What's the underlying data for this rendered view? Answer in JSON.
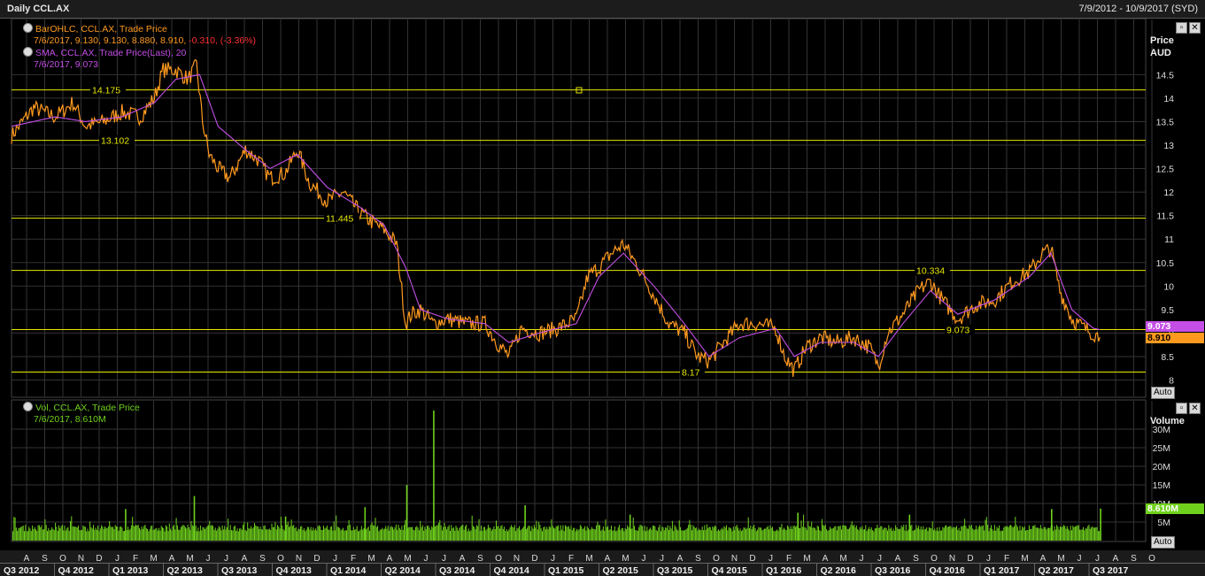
{
  "header": {
    "title": "Daily CCL.AX",
    "range": "7/9/2012 - 10/9/2017 (SYD)"
  },
  "legend": {
    "ohlc_name": "BarOHLC, CCL.AX, Trade Price",
    "ohlc_values": "7/6/2017, 9.130, 9.130, 8.880, 8.910,",
    "ohlc_change": "-0.310, (-3.36%)",
    "sma_name": "SMA, CCL.AX, Trade Price(Last), ",
    "sma_period": "20",
    "sma_values": "7/6/2017, 9.073",
    "vol_name": "Vol, CCL.AX, Trade Price",
    "vol_values": "7/6/2017, 8.610M"
  },
  "axis": {
    "price_title_1": "Price",
    "price_title_2": "AUD",
    "volume_title": "Volume",
    "auto_label": "Auto"
  },
  "tags": {
    "sma": "9.073",
    "last": "8.910",
    "volume": "8.610M"
  },
  "colors": {
    "price": "#ff9a1f",
    "sma": "#c44ee6",
    "volume": "#6fd11c",
    "hline": "#e8e800",
    "bg": "#000000",
    "grid": "#333333"
  },
  "chart_data": [
    {
      "type": "line",
      "title": "Daily CCL.AX",
      "ylabel": "Price AUD",
      "ylim": [
        8.0,
        14.8
      ],
      "yticks": [
        8,
        8.5,
        9,
        9.5,
        10,
        10.5,
        11,
        11.5,
        12,
        12.5,
        13,
        13.5,
        14,
        14.5
      ],
      "series": [
        {
          "name": "BarOHLC, CCL.AX, Trade Price",
          "x": [
            "2012-07-09",
            "2012-08-15",
            "2012-09-20",
            "2012-10-20",
            "2012-11-10",
            "2012-12-10",
            "2013-01-10",
            "2013-02-10",
            "2013-03-05",
            "2013-03-20",
            "2013-04-10",
            "2013-05-01",
            "2013-05-15",
            "2013-05-25",
            "2013-06-05",
            "2013-06-20",
            "2013-07-10",
            "2013-08-05",
            "2013-08-25",
            "2013-09-15",
            "2013-10-10",
            "2013-10-31",
            "2013-11-20",
            "2013-12-20",
            "2014-01-15",
            "2014-02-10",
            "2014-02-28",
            "2014-03-25",
            "2014-04-15",
            "2014-04-30",
            "2014-05-10",
            "2014-05-25",
            "2014-06-15",
            "2014-07-10",
            "2014-08-10",
            "2014-09-10",
            "2014-09-30",
            "2014-10-20",
            "2014-11-10",
            "2014-12-10",
            "2015-01-10",
            "2015-02-10",
            "2015-03-01",
            "2015-03-20",
            "2015-04-10",
            "2015-04-30",
            "2015-05-25",
            "2015-06-20",
            "2015-07-15",
            "2015-08-10",
            "2015-09-01",
            "2015-09-20",
            "2015-10-15",
            "2015-11-10",
            "2015-12-10",
            "2016-01-10",
            "2016-01-25",
            "2016-02-10",
            "2016-03-01",
            "2016-03-25",
            "2016-04-20",
            "2016-05-20",
            "2016-06-15",
            "2016-06-30",
            "2016-07-15",
            "2016-08-10",
            "2016-09-05",
            "2016-09-25",
            "2016-10-15",
            "2016-11-10",
            "2016-12-10",
            "2017-01-10",
            "2017-02-10",
            "2017-03-10",
            "2017-04-01",
            "2017-04-15",
            "2017-04-30",
            "2017-05-20",
            "2017-06-10",
            "2017-06-25",
            "2017-07-06"
          ],
          "values": [
            13.2,
            13.8,
            13.6,
            13.9,
            13.4,
            13.5,
            13.7,
            13.6,
            14.0,
            14.6,
            14.6,
            14.4,
            14.7,
            13.5,
            12.8,
            12.5,
            12.3,
            12.9,
            12.7,
            12.3,
            12.4,
            12.9,
            12.2,
            11.8,
            12.0,
            11.6,
            11.4,
            11.2,
            10.9,
            9.2,
            9.4,
            9.5,
            9.2,
            9.3,
            9.2,
            9.2,
            8.8,
            8.5,
            9.1,
            9.0,
            9.1,
            9.3,
            10.2,
            10.4,
            10.7,
            10.9,
            10.4,
            9.8,
            9.2,
            9.0,
            8.5,
            8.4,
            8.8,
            9.2,
            9.2,
            9.1,
            8.5,
            8.2,
            8.7,
            8.9,
            8.8,
            8.9,
            8.7,
            8.3,
            9.0,
            9.4,
            9.9,
            10.1,
            9.7,
            9.3,
            9.6,
            9.7,
            10.1,
            10.3,
            10.7,
            10.8,
            9.9,
            9.3,
            9.1,
            9.0,
            8.91
          ]
        },
        {
          "name": "SMA, CCL.AX, Trade Price(Last), 20",
          "x": [
            "2012-07-09",
            "2012-09-20",
            "2012-11-10",
            "2013-01-10",
            "2013-03-05",
            "2013-04-10",
            "2013-05-20",
            "2013-06-20",
            "2013-08-05",
            "2013-09-15",
            "2013-10-31",
            "2013-12-20",
            "2014-02-10",
            "2014-03-25",
            "2014-04-30",
            "2014-05-25",
            "2014-07-10",
            "2014-09-10",
            "2014-10-20",
            "2014-12-10",
            "2015-02-10",
            "2015-03-20",
            "2015-04-30",
            "2015-06-20",
            "2015-08-10",
            "2015-09-20",
            "2015-11-10",
            "2016-01-10",
            "2016-02-10",
            "2016-03-25",
            "2016-05-20",
            "2016-06-30",
            "2016-08-10",
            "2016-09-25",
            "2016-11-10",
            "2017-01-10",
            "2017-03-10",
            "2017-04-15",
            "2017-05-20",
            "2017-06-25",
            "2017-07-06"
          ],
          "values": [
            13.4,
            13.6,
            13.5,
            13.6,
            13.9,
            14.4,
            14.5,
            13.4,
            12.9,
            12.5,
            12.8,
            12.1,
            11.7,
            11.3,
            10.4,
            9.5,
            9.3,
            9.2,
            8.8,
            9.0,
            9.2,
            10.2,
            10.7,
            10.0,
            9.2,
            8.5,
            8.9,
            9.1,
            8.5,
            8.8,
            8.8,
            8.5,
            9.2,
            9.9,
            9.4,
            9.7,
            10.2,
            10.7,
            9.5,
            9.1,
            9.073
          ]
        }
      ],
      "annotations": [
        {
          "label": "14.175",
          "y": 14.175
        },
        {
          "label": "13.102",
          "y": 13.102
        },
        {
          "label": "11.445",
          "y": 11.445
        },
        {
          "label": "10.334",
          "y": 10.334
        },
        {
          "label": "9.073",
          "y": 9.073
        },
        {
          "label": "8.17",
          "y": 8.17
        }
      ]
    },
    {
      "type": "bar",
      "title": "Vol, CCL.AX, Trade Price",
      "ylabel": "Volume",
      "ylim": [
        0,
        35
      ],
      "yticks": [
        5,
        10,
        15,
        20,
        25,
        30
      ],
      "ytick_labels": [
        "5M",
        "10M",
        "15M",
        "20M",
        "25M",
        "30M"
      ],
      "baseline_millions": 2.5,
      "spikes": [
        {
          "x": "2013-01-15",
          "value": 8.5
        },
        {
          "x": "2013-05-10",
          "value": 12.0
        },
        {
          "x": "2013-10-10",
          "value": 6.5
        },
        {
          "x": "2014-02-20",
          "value": 9.0
        },
        {
          "x": "2014-05-01",
          "value": 15.0
        },
        {
          "x": "2014-06-15",
          "value": 35.0
        },
        {
          "x": "2014-11-15",
          "value": 9.5
        },
        {
          "x": "2015-05-10",
          "value": 7.0
        },
        {
          "x": "2016-02-15",
          "value": 7.5
        },
        {
          "x": "2016-08-20",
          "value": 7.0
        },
        {
          "x": "2017-04-15",
          "value": 8.5
        },
        {
          "x": "2017-07-06",
          "value": 8.61
        }
      ]
    }
  ],
  "xaxis": {
    "months": [
      "A",
      "S",
      "O",
      "N",
      "D",
      "J",
      "F",
      "M",
      "A",
      "M",
      "J",
      "J",
      "A",
      "S",
      "O",
      "N",
      "D",
      "J",
      "F",
      "M",
      "A",
      "M",
      "J",
      "J",
      "A",
      "S",
      "O",
      "N",
      "D",
      "J",
      "F",
      "M",
      "A",
      "M",
      "J",
      "J",
      "A",
      "S",
      "O",
      "N",
      "D",
      "J",
      "F",
      "M",
      "A",
      "M",
      "J",
      "J",
      "A",
      "S",
      "O",
      "N",
      "D",
      "J",
      "F",
      "M",
      "A",
      "M",
      "J",
      "J",
      "A",
      "S",
      "O"
    ],
    "quarters": [
      "Q3 2012",
      "Q4 2012",
      "Q1 2013",
      "Q2 2013",
      "Q3 2013",
      "Q4 2013",
      "Q1 2014",
      "Q2 2014",
      "Q3 2014",
      "Q4 2014",
      "Q1 2015",
      "Q2 2015",
      "Q3 2015",
      "Q4 2015",
      "Q1 2016",
      "Q2 2016",
      "Q3 2016",
      "Q4 2016",
      "Q1 2017",
      "Q2 2017",
      "Q3 2017"
    ]
  }
}
